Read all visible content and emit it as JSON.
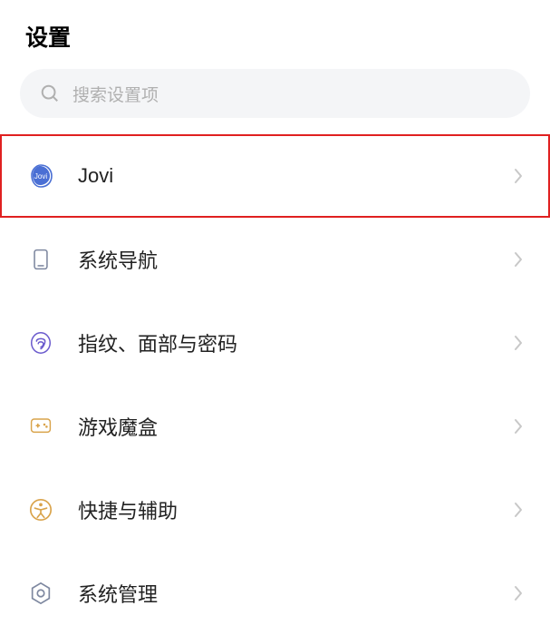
{
  "header": {
    "title": "设置"
  },
  "search": {
    "placeholder": "搜索设置项"
  },
  "items": [
    {
      "icon": "jovi",
      "label": "Jovi",
      "highlighted": true
    },
    {
      "icon": "navigation",
      "label": "系统导航",
      "highlighted": false
    },
    {
      "icon": "fingerprint",
      "label": "指纹、面部与密码",
      "highlighted": false
    },
    {
      "icon": "gamebox",
      "label": "游戏魔盒",
      "highlighted": false
    },
    {
      "icon": "accessibility",
      "label": "快捷与辅助",
      "highlighted": false
    },
    {
      "icon": "system",
      "label": "系统管理",
      "highlighted": false
    }
  ]
}
